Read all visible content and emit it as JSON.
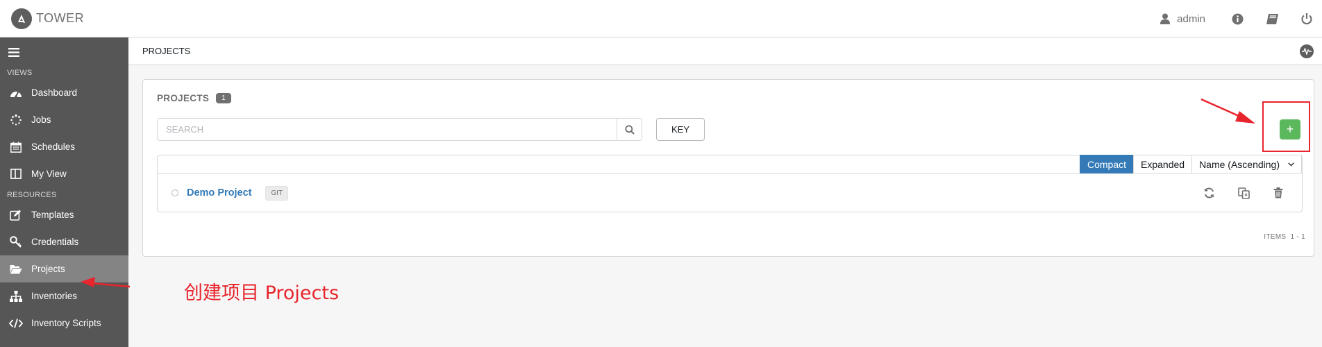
{
  "header": {
    "app_name": "TOWER",
    "username": "admin",
    "icons": [
      "user-icon",
      "info-icon",
      "book-icon",
      "power-icon"
    ]
  },
  "sidebar": {
    "sections": [
      {
        "heading": "VIEWS",
        "items": [
          {
            "label": "Dashboard",
            "icon": "dashboard-icon"
          },
          {
            "label": "Jobs",
            "icon": "spinner-icon"
          },
          {
            "label": "Schedules",
            "icon": "calendar-icon"
          },
          {
            "label": "My View",
            "icon": "columns-icon"
          }
        ]
      },
      {
        "heading": "RESOURCES",
        "items": [
          {
            "label": "Templates",
            "icon": "edit-icon"
          },
          {
            "label": "Credentials",
            "icon": "key-icon"
          },
          {
            "label": "Projects",
            "icon": "folder-open-icon",
            "active": true
          },
          {
            "label": "Inventories",
            "icon": "sitemap-icon"
          },
          {
            "label": "Inventory Scripts",
            "icon": "code-icon"
          }
        ]
      }
    ]
  },
  "breadcrumb": {
    "label": "PROJECTS"
  },
  "panel": {
    "title": "PROJECTS",
    "count": "1",
    "search_placeholder": "SEARCH",
    "key_label": "KEY",
    "add_label": "+",
    "view_toggle": {
      "compact": "Compact",
      "expanded": "Expanded",
      "active": "compact"
    },
    "sort_label": "Name (Ascending)",
    "rows": [
      {
        "name": "Demo Project",
        "scm_type": "GIT"
      }
    ],
    "items_label": "ITEMS",
    "items_range": "1 - 1"
  },
  "annotation": {
    "text": "创建项目 Projects",
    "color": "#e8242c"
  },
  "colors": {
    "sidebar_bg": "#565656",
    "sidebar_active": "#848484",
    "primary": "#337ab7",
    "add_button": "#5cb85c"
  }
}
